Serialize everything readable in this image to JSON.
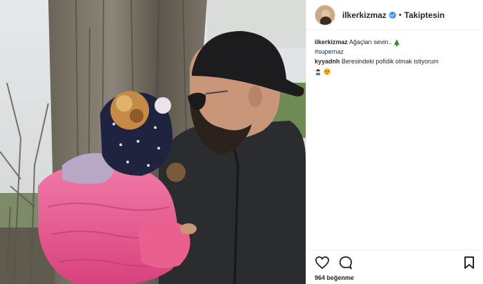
{
  "post": {
    "username": "ilkerkizmaz",
    "separator": "•",
    "follow_label": "Takiptesin",
    "caption_text": "Ağaçları sevin..",
    "hashtag": "#supernaz",
    "comments": [
      {
        "username": "kyyadnh",
        "text": "Beresindeki pofidik olmak istiyorum"
      }
    ],
    "likes": "964 beğenme"
  },
  "icons": {
    "verified": "verified-badge-icon",
    "tree": "christmas-tree-icon",
    "like": "heart-icon",
    "comment": "comment-bubble-icon",
    "save": "bookmark-icon"
  },
  "colors": {
    "verified": "#3897f0",
    "hashtag": "#003569",
    "border": "#efefef"
  }
}
